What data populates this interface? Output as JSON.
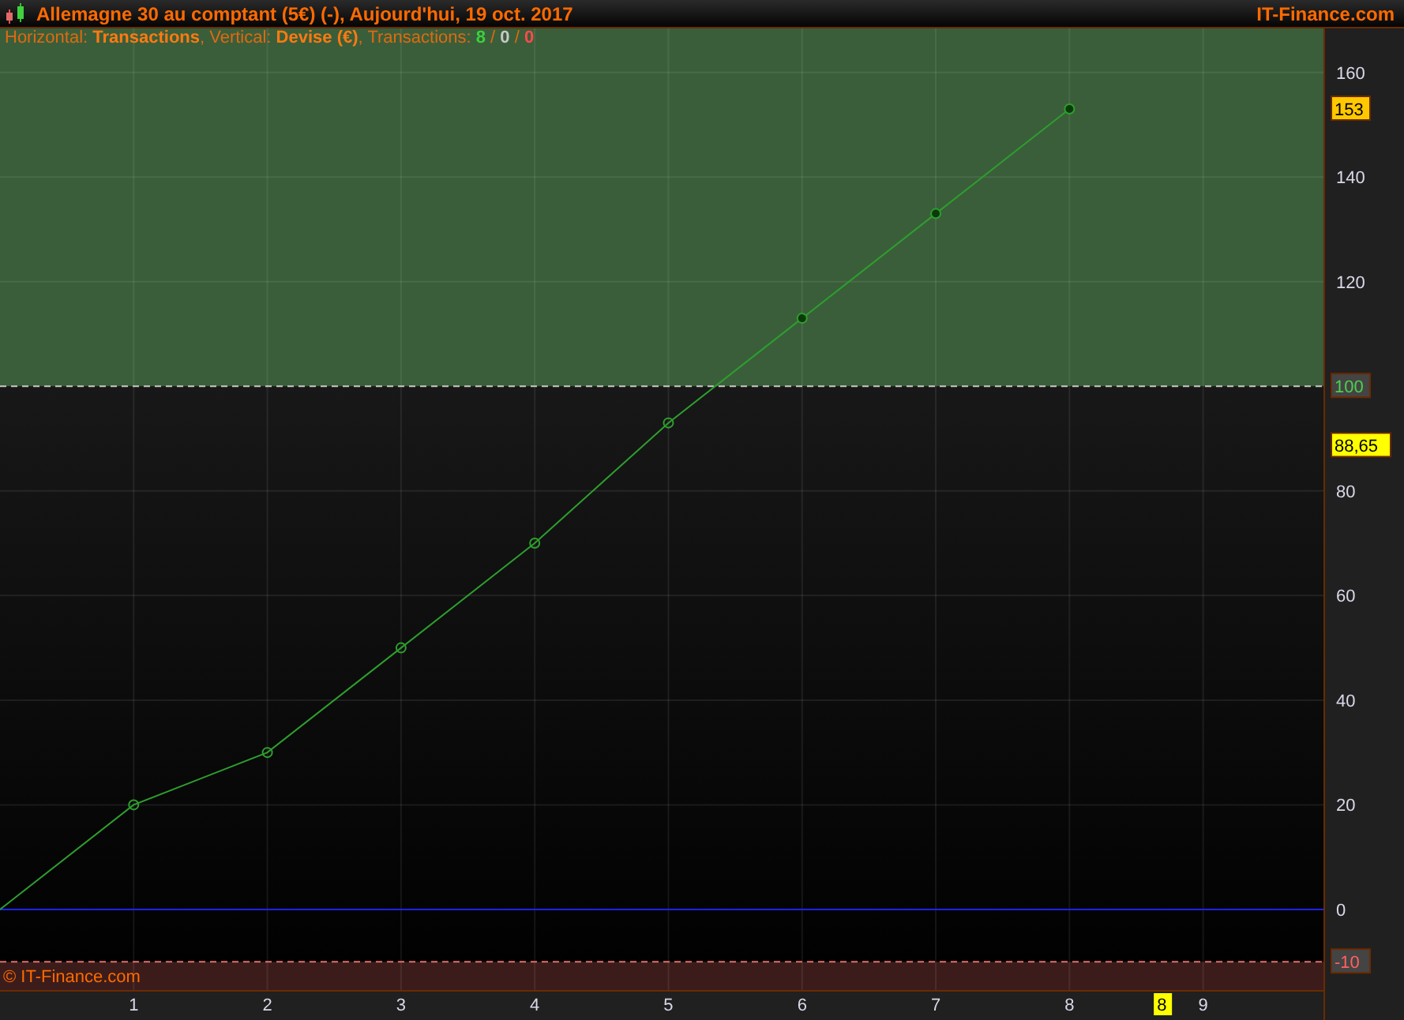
{
  "window": {
    "title": "Allemagne 30 au comptant (5€) (-), Aujourd'hui, 19 oct. 2017",
    "brand": "IT-Finance.com"
  },
  "legend": [
    {
      "text": "Horizontal: ",
      "kind": "plain"
    },
    {
      "kind": "xlabel"
    },
    {
      "text": ", Vertical: ",
      "kind": "plain"
    },
    {
      "kind": "series"
    },
    {
      "text": ", Transactions: ",
      "kind": "plain"
    },
    {
      "text": "8",
      "kind": "win"
    },
    {
      "text": " / ",
      "kind": "plain"
    },
    {
      "text": "0",
      "kind": "neutral"
    },
    {
      "text": " / ",
      "kind": "plain"
    },
    {
      "text": "0",
      "kind": "loss"
    }
  ],
  "copyright": "© IT-Finance.com",
  "chart_data": {
    "type": "line",
    "xlabel": "Transactions",
    "x": [
      0,
      1,
      2,
      3,
      4,
      5,
      6,
      7,
      8
    ],
    "series": [
      {
        "name": "Devise (€)",
        "color": "#2e9e2e",
        "marker": "circle",
        "values": [
          0,
          20,
          30,
          50,
          70,
          93,
          113,
          133,
          153
        ]
      }
    ],
    "grid": true,
    "xlim": [
      0,
      9.9
    ],
    "ylim": [
      -15.4,
      168.4
    ],
    "xticks": [
      1,
      2,
      3,
      4,
      5,
      6,
      7,
      8,
      9
    ],
    "yticks": [
      0,
      20,
      40,
      60,
      80,
      120,
      140,
      160
    ],
    "ref_lines": [
      {
        "axis": "y",
        "value": 100,
        "label": "100",
        "color": "#c8c8c8"
      },
      {
        "axis": "y",
        "value": -10,
        "label": "-10",
        "color": "#e07070"
      },
      {
        "axis": "y",
        "value": 0,
        "color": "#2020ff"
      }
    ],
    "annotations": [
      "153",
      "88,65",
      "8"
    ]
  }
}
